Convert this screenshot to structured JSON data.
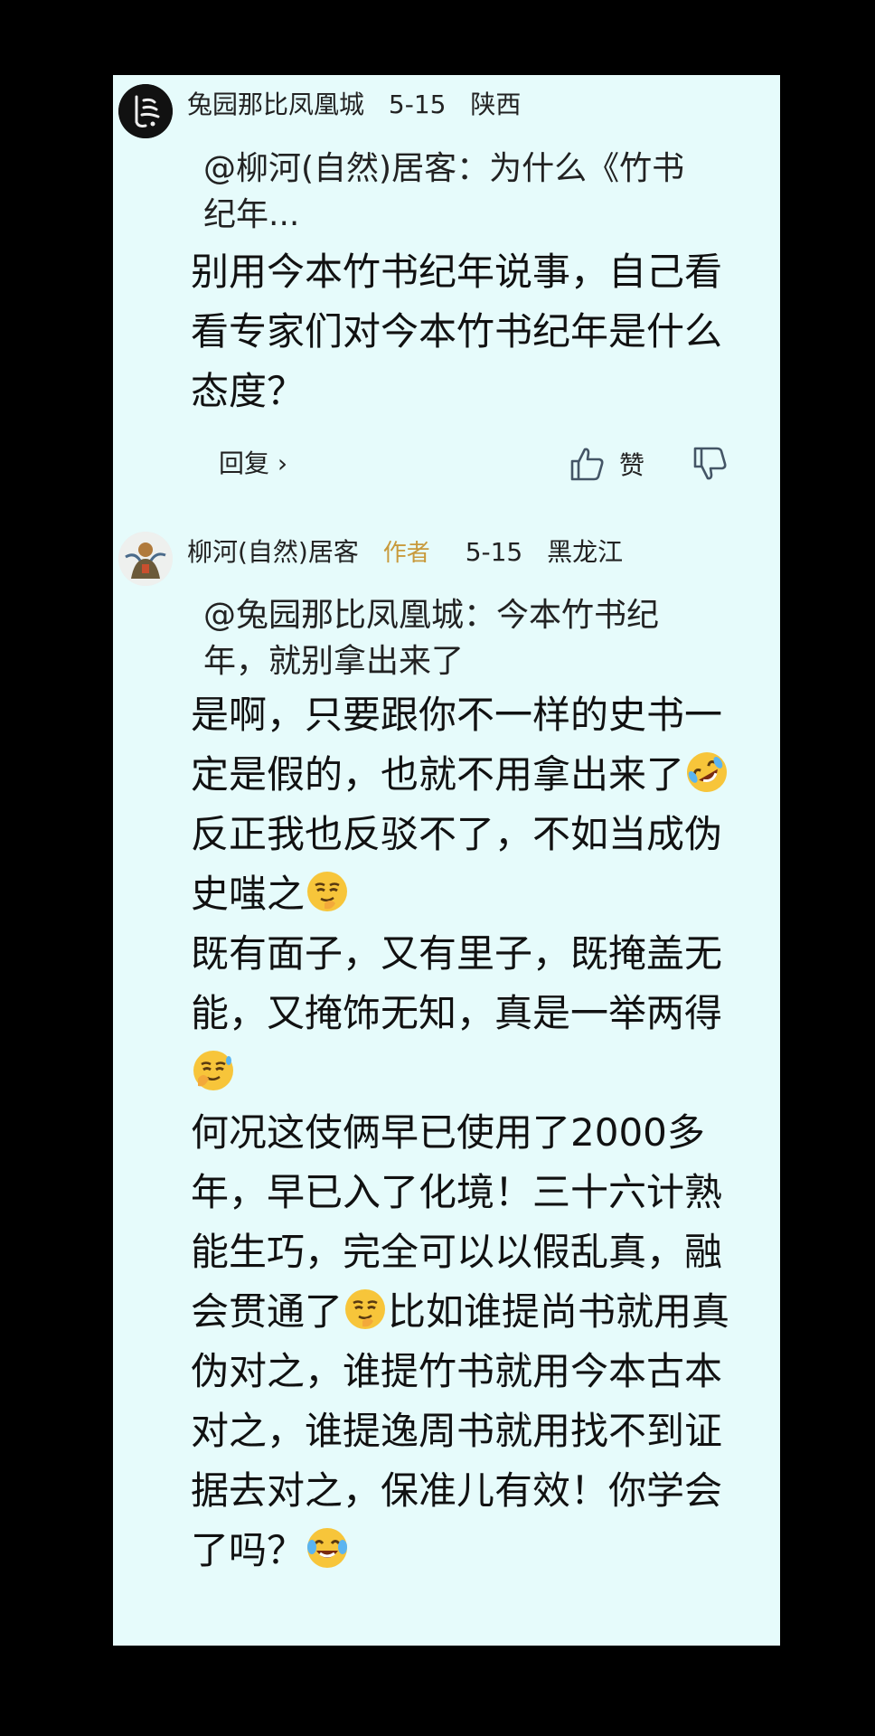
{
  "comments": [
    {
      "username": "兔园那比凤凰城",
      "author_tag": "",
      "date": "5-15",
      "location": "陕西",
      "quote": "@柳河(自然)居客：为什么《竹书纪年...",
      "body": [
        "别用今本竹书纪年说事，自己看看专家们对今本竹书纪年是什么态度？"
      ],
      "actions": {
        "reply": "回复 ›",
        "like": "赞"
      }
    },
    {
      "username": "柳河(自然)居客",
      "author_tag": "作者",
      "date": "5-15",
      "location": "黑龙江",
      "quote": "@兔园那比凤凰城：今本竹书纪年，就别拿出来了",
      "body": [
        "是啊，只要跟你不一样的史书一定是假的，也就不用拿出来了",
        "反正我也反驳不了，不如当成伪史嗤之",
        "既有面子，又有里子，既掩盖无能，又掩饰无知，真是一举两得",
        "何况这伎俩早已使用了2000多年，早已入了化境！三十六计熟能生巧，完全可以以假乱真，融会贯通了",
        "比如谁提尚书就用真伪对之，谁提竹书就用今本古本对之，谁提逸周书就用找不到证据去对之，保准儿有效！你学会了吗？"
      ]
    }
  ],
  "icons": {
    "avatar1": "calligraphy-logo-icon",
    "avatar2": "figure-illustration-icon",
    "like": "thumbs-up-icon",
    "dislike": "thumbs-down-icon",
    "emoji_cry_laugh": "rolling-laughing-face-icon",
    "emoji_smirk": "smirking-hand-face-icon",
    "emoji_laugh": "tears-of-joy-face-icon"
  },
  "colors": {
    "panel": "#e6fbfb",
    "author_tag": "#c89a3c",
    "emoji": "#f7c53a"
  }
}
